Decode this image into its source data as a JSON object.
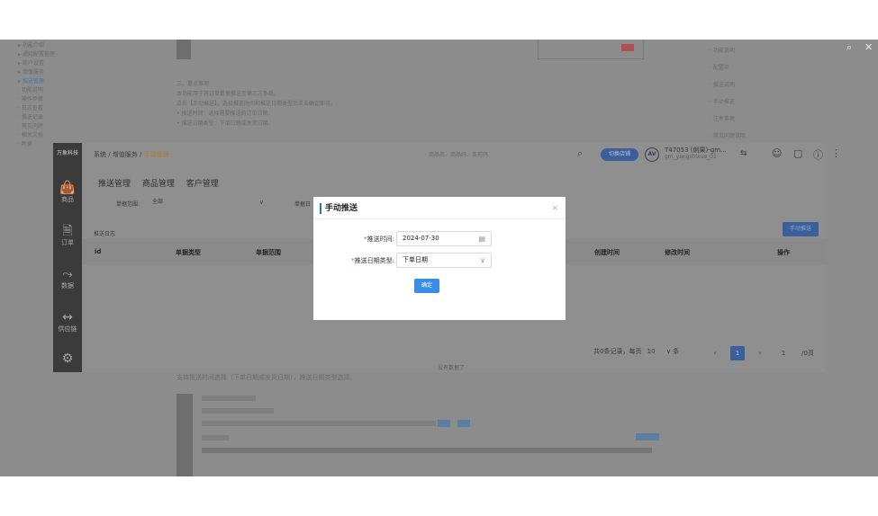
{
  "background_doc": {
    "toc": [
      "▸ 功能介绍",
      "▸ 通知配置管理",
      "▸ 商户设置",
      "▸ 增值服务",
      "▸ 推送管理",
      "· 功能说明",
      "· 操作步骤",
      "· 日志查看",
      "· 推送记录",
      "· 常见问题",
      "· 相关文档",
      "· 附录"
    ],
    "body_lines": [
      "三、重点事项",
      "本功能用于将订单数据推送至第三方系统。",
      "点击【手动推送】，选择推送时间和推送日期类型后点击确定即可。",
      "• 推送时间：选择需要推送的订单日期。",
      "• 推送日期类型：下单日期或发货日期。"
    ],
    "right_lines": [
      "· 功能说明",
      "· 配置项",
      "· 推送说明",
      "· 手动推送",
      "· 注意事项",
      "· 常见问题说明"
    ],
    "bottom_note": "支持推送时间选择（下单日期或发货日期），推送日期类型选择。"
  },
  "app": {
    "brand": "万象科技",
    "sidebar": [
      {
        "label": "商品",
        "icon": "bag"
      },
      {
        "label": "订单",
        "icon": "doc"
      },
      {
        "label": "数据",
        "icon": "chart"
      },
      {
        "label": "供应链",
        "icon": "link"
      },
      {
        "label": "",
        "icon": "cog"
      }
    ],
    "breadcrumb": {
      "a": "系统",
      "b": "增值服务",
      "c": "手动管理"
    },
    "search_placeholder": "商品名、商品码、条形码",
    "shop_pill": "切换店铺",
    "avatar": "AV",
    "user_name": "T47053 (俐果)-gm...",
    "user_sub": "gm_yangshixue_01",
    "tabs": [
      "推送管理",
      "商品管理",
      "客户管理"
    ],
    "filter_label": "单据范围:",
    "filter_value": "全部",
    "filter_label2": "单据日",
    "log_title": "推送日志",
    "manual_button": "手动推送",
    "columns": [
      "id",
      "单据类型",
      "单据范围",
      "创建时间",
      "修改时间",
      "操作"
    ],
    "no_data": "没有数据了",
    "pager_text": "共0条记录，每页",
    "page_size": "10",
    "page_size_unit": "条",
    "current_page": "1",
    "goto_page": "1",
    "total_pages": "/0页"
  },
  "modal": {
    "title": "手动推送",
    "close": "×",
    "date_label": "推送时间:",
    "date_value": "2024-07-30",
    "type_label": "推送日期类型:",
    "type_value": "下单日期",
    "confirm": "确定"
  },
  "viewer_tools": {
    "search": "⌕",
    "close": "✕"
  }
}
